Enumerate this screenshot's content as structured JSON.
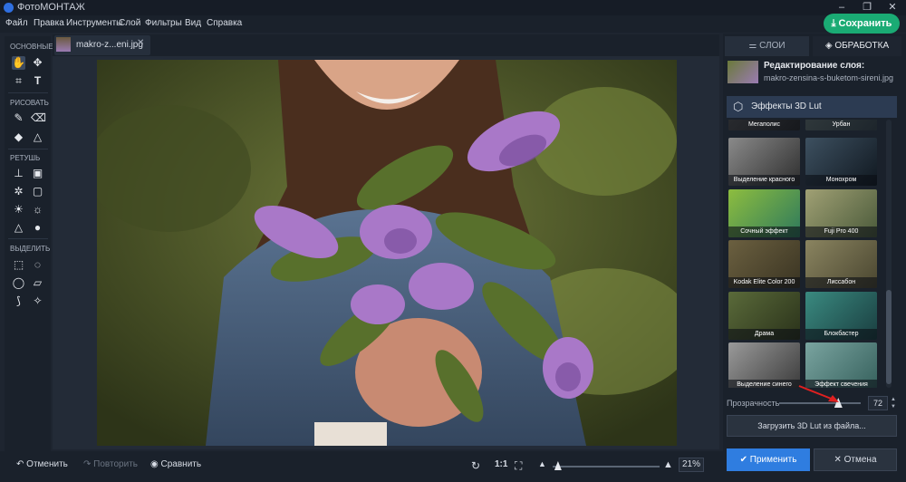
{
  "app": {
    "title": "ФотоМОНТАЖ"
  },
  "menu": [
    "Файл",
    "Правка",
    "Инструменты",
    "Слой",
    "Фильтры",
    "Вид",
    "Справка"
  ],
  "save_label": "Сохранить",
  "toolbox": {
    "groups": [
      "ОСНОВНЫЕ",
      "РИСОВАТЬ",
      "РЕТУШЬ",
      "ВЫДЕЛИТЬ"
    ]
  },
  "document_tab": {
    "label": "makro-z...eni.jpg"
  },
  "bottom": {
    "undo": "Отменить",
    "redo": "Повторить",
    "compare": "Сравнить",
    "ratio": "1:1",
    "zoom": "21%",
    "zoom_fraction": 0.05
  },
  "right_panel": {
    "tabs": [
      "СЛОИ",
      "ОБРАБОТКА"
    ],
    "layer_title": "Редактирование слоя:",
    "layer_file": "makro-zensina-s-buketom-sireni.jpg",
    "effects_title": "Эффекты 3D Lut",
    "effects": [
      "Мегаполис",
      "Урбан",
      "Выделение красного",
      "Монохром",
      "Сочный эффект",
      "Fuji Pro 400",
      "Kodak Elite Color 200",
      "Лиссабон",
      "Драма",
      "Блокбастер",
      "Выделение синего",
      "Эффект свечения"
    ],
    "opacity_label": "Прозрачность",
    "opacity_value": "72",
    "load_lut": "Загрузить 3D Lut из файла...",
    "apply": "Применить",
    "cancel": "Отмена"
  }
}
